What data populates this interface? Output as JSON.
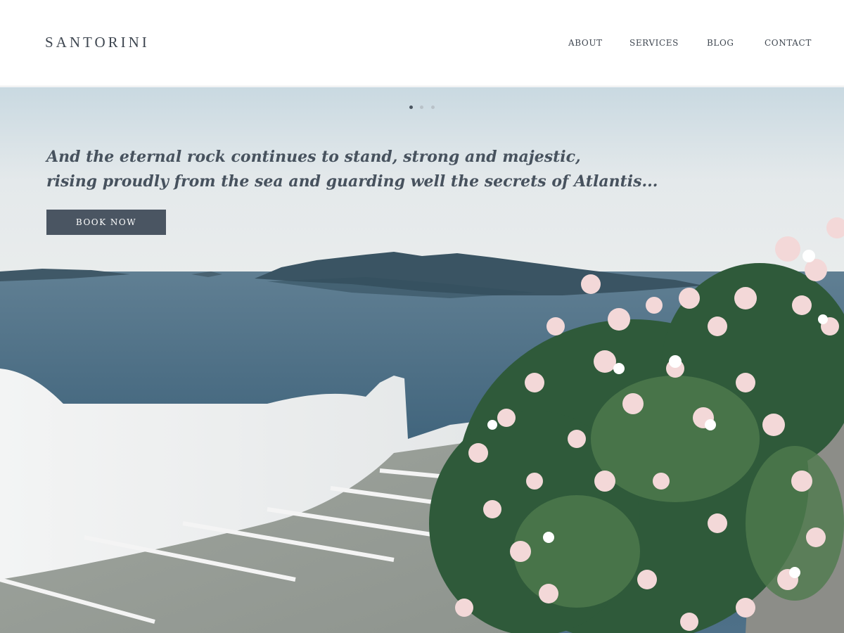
{
  "site": {
    "logo": "SANTORINI"
  },
  "nav": {
    "items": [
      {
        "label": "ABOUT"
      },
      {
        "label": "SERVICES"
      },
      {
        "label": "BLOG"
      },
      {
        "label": "CONTACT"
      }
    ]
  },
  "hero": {
    "tagline_line1": "And the eternal rock continues to stand, strong and majestic,",
    "tagline_line2": "rising proudly from the sea and guarding well the secrets of Atlantis...",
    "cta_label": "BOOK NOW",
    "slider": {
      "slide_count": 3,
      "active_slide": 1
    },
    "image_icon": "santorini-photo"
  },
  "colors": {
    "brand_text": "#3e4650",
    "button_bg": "#4a5562",
    "button_text": "#ffffff"
  }
}
